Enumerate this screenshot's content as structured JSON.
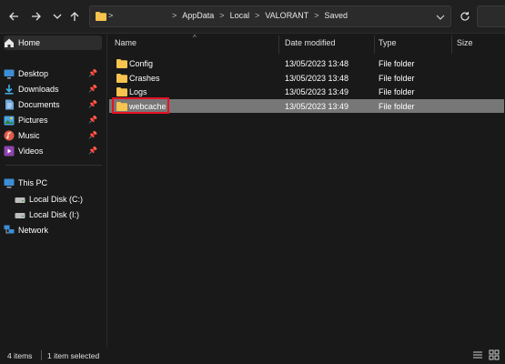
{
  "address": {
    "separator_label": ">",
    "breadcrumbs": [
      "AppData",
      "Local",
      "VALORANT",
      "Saved"
    ],
    "chevron": ">"
  },
  "sidebar": {
    "items": [
      {
        "label": "Home",
        "icon": "home-icon",
        "selected": true
      },
      {
        "label": "Desktop",
        "icon": "desktop-icon",
        "pinned": true
      },
      {
        "label": "Downloads",
        "icon": "downloads-icon",
        "pinned": true
      },
      {
        "label": "Documents",
        "icon": "documents-icon",
        "pinned": true
      },
      {
        "label": "Pictures",
        "icon": "pictures-icon",
        "pinned": true
      },
      {
        "label": "Music",
        "icon": "music-icon",
        "pinned": true
      },
      {
        "label": "Videos",
        "icon": "videos-icon",
        "pinned": true
      },
      {
        "label": "This PC",
        "icon": "this-pc-icon"
      },
      {
        "label": "Local Disk (C:)",
        "icon": "drive-icon"
      },
      {
        "label": "Local Disk (I:)",
        "icon": "drive-icon"
      },
      {
        "label": "Network",
        "icon": "network-icon"
      }
    ]
  },
  "columns": {
    "name": "Name",
    "date_modified": "Date modified",
    "type": "Type",
    "size": "Size"
  },
  "files": [
    {
      "name": "Config",
      "date": "13/05/2023 13:48",
      "type": "File folder"
    },
    {
      "name": "Crashes",
      "date": "13/05/2023 13:48",
      "type": "File folder"
    },
    {
      "name": "Logs",
      "date": "13/05/2023 13:49",
      "type": "File folder"
    },
    {
      "name": "webcache",
      "date": "13/05/2023 13:49",
      "type": "File folder",
      "selected": true,
      "highlighted": true
    }
  ],
  "status": {
    "item_count": "4 items",
    "selection": "1 item selected"
  },
  "colors": {
    "folder": "#f6c44f",
    "highlight_box": "#e81123",
    "selected_row": "#777777"
  }
}
